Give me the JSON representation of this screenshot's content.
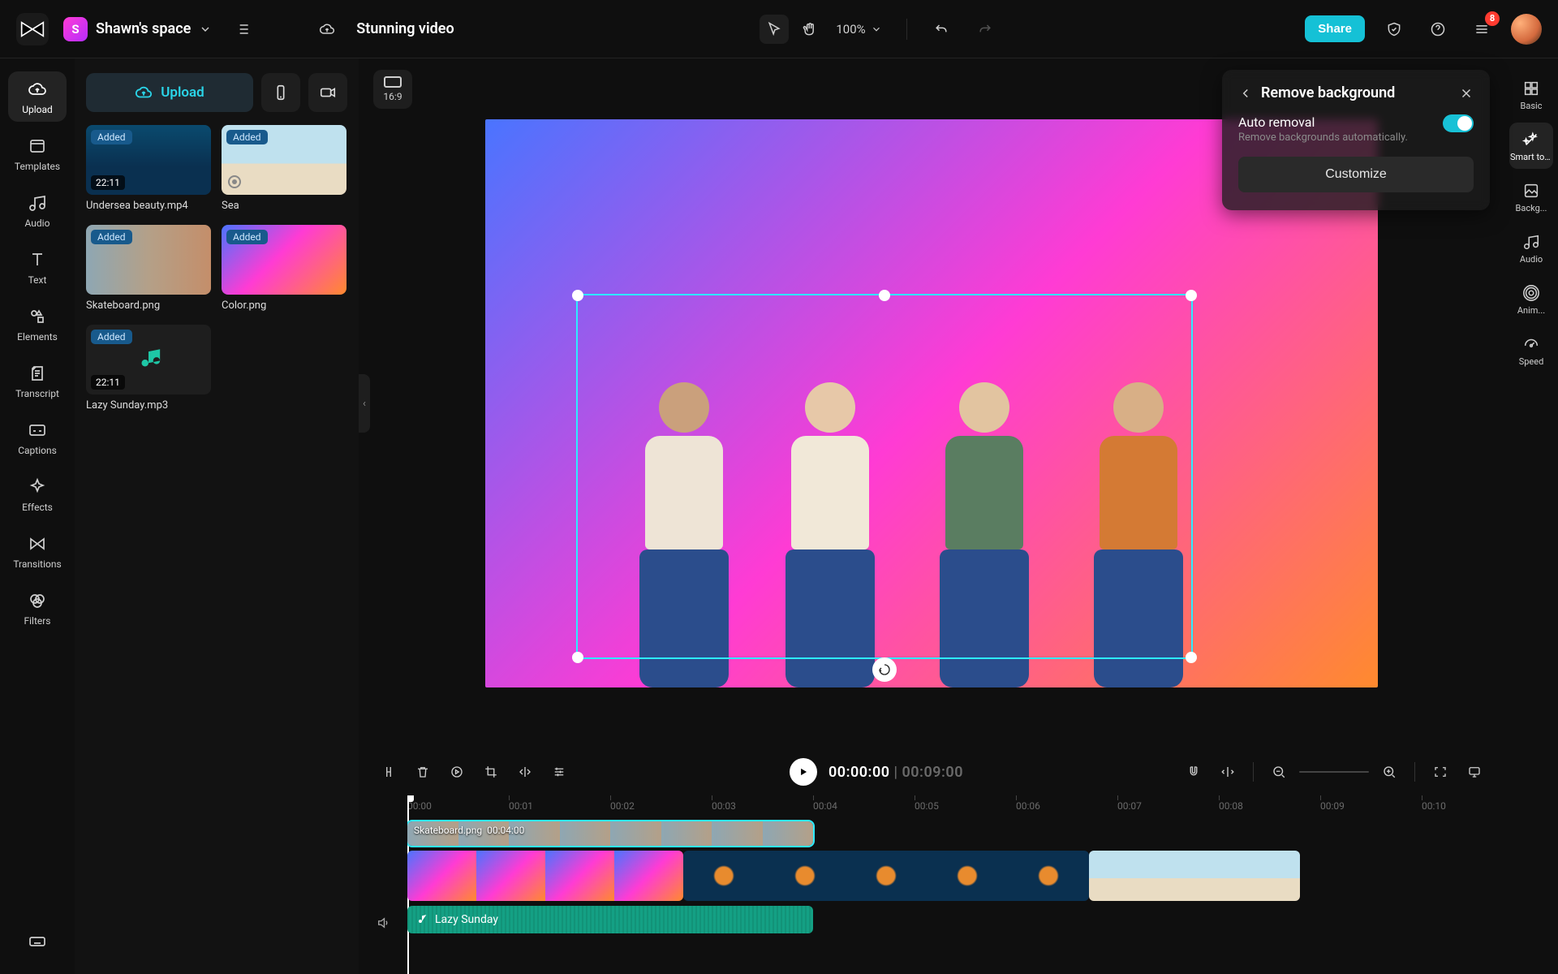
{
  "header": {
    "space_initial": "S",
    "space_name": "Shawn's space",
    "project_title": "Stunning video",
    "zoom": "100%",
    "share": "Share",
    "notif_count": "8"
  },
  "rail": {
    "items": [
      {
        "id": "upload",
        "label": "Upload"
      },
      {
        "id": "templates",
        "label": "Templates"
      },
      {
        "id": "audio",
        "label": "Audio"
      },
      {
        "id": "text",
        "label": "Text"
      },
      {
        "id": "elements",
        "label": "Elements"
      },
      {
        "id": "transcript",
        "label": "Transcript"
      },
      {
        "id": "captions",
        "label": "Captions"
      },
      {
        "id": "effects",
        "label": "Effects"
      },
      {
        "id": "transitions",
        "label": "Transitions"
      },
      {
        "id": "filters",
        "label": "Filters"
      }
    ]
  },
  "media": {
    "upload_label": "Upload",
    "added_tag": "Added",
    "items": [
      {
        "name": "Undersea beauty.mp4",
        "dur": "22:11",
        "kind": "undersea",
        "added": true
      },
      {
        "name": "Sea",
        "kind": "sea",
        "added": true,
        "rec": true
      },
      {
        "name": "Skateboard.png",
        "kind": "skate",
        "added": true
      },
      {
        "name": "Color.png",
        "kind": "color",
        "added": true
      },
      {
        "name": "Lazy Sunday.mp3",
        "dur": "22:11",
        "kind": "audio",
        "added": true
      }
    ]
  },
  "canvas": {
    "aspect_label": "16:9"
  },
  "popover": {
    "title": "Remove background",
    "row_label": "Auto removal",
    "row_sub": "Remove backgrounds automatically.",
    "customize": "Customize"
  },
  "prop_rail": {
    "items": [
      {
        "id": "basic",
        "label": "Basic"
      },
      {
        "id": "smart",
        "label": "Smart tools"
      },
      {
        "id": "backg",
        "label": "Backg..."
      },
      {
        "id": "audio",
        "label": "Audio"
      },
      {
        "id": "anim",
        "label": "Anim..."
      },
      {
        "id": "speed",
        "label": "Speed"
      }
    ]
  },
  "playback": {
    "current": "00:00:00",
    "duration": "00:09:00"
  },
  "ruler": {
    "ticks": [
      "00:00",
      "00:01",
      "00:02",
      "00:03",
      "00:04",
      "00:05",
      "00:06",
      "00:07",
      "00:08",
      "00:09",
      "00:10"
    ]
  },
  "clips": {
    "skate_label": "Skateboard.png",
    "skate_dur": "00:04:00",
    "audio_label": "Lazy Sunday"
  },
  "colors": {
    "accent": "#15c1d6",
    "selection": "#2debff",
    "audio_clip": "#14a084"
  }
}
